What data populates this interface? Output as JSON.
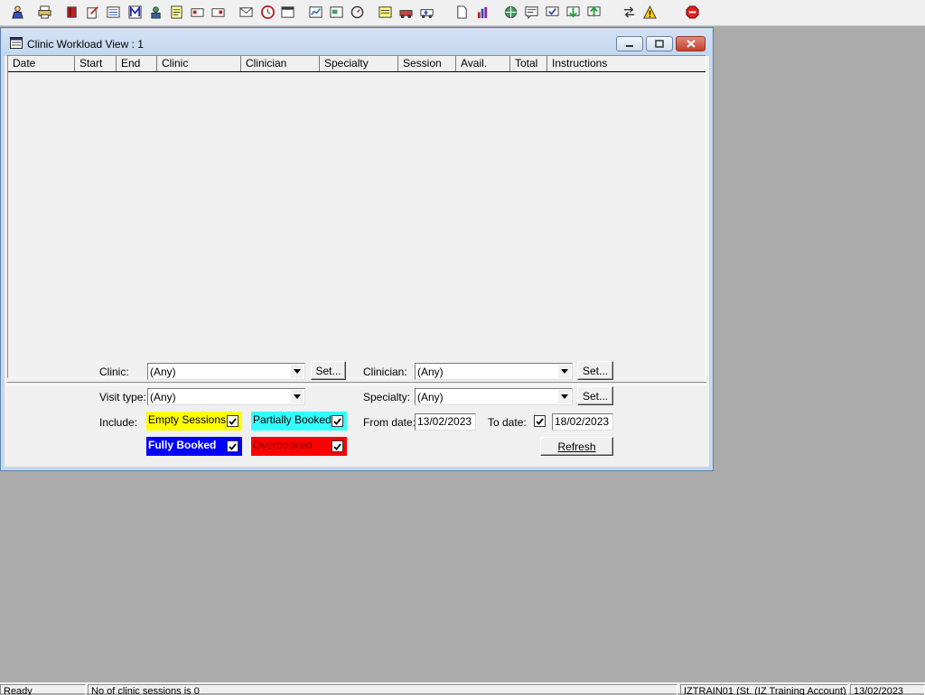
{
  "window": {
    "title": "Clinic Workload View : 1"
  },
  "list": {
    "columns": [
      "Date",
      "Start",
      "End",
      "Clinic",
      "Clinician",
      "Specialty",
      "Session",
      "Avail.",
      "Total",
      "Instructions"
    ],
    "rows": []
  },
  "form": {
    "clinic_label": "Clinic:",
    "clinic_value": "(Any)",
    "clinician_label": "Clinician:",
    "clinician_value": "(Any)",
    "visit_type_label": "Visit type:",
    "visit_type_value": "(Any)",
    "specialty_label": "Specialty:",
    "specialty_value": "(Any)",
    "set_label": "Set...",
    "include_label": "Include:",
    "empty_sessions": {
      "label": "Empty Sessions",
      "checked": true,
      "color": "#ffff00"
    },
    "partially_booked": {
      "label": "Partially Booked",
      "checked": true,
      "color": "#33ffff"
    },
    "fully_booked": {
      "label": "Fully Booked",
      "checked": true,
      "color": "#0000ff"
    },
    "overbooked": {
      "label": "Overbooked",
      "checked": true,
      "color": "#ff0000"
    },
    "from_date_label": "From date:",
    "from_date": "13/02/2023",
    "to_date_label": "To date:",
    "to_date_checked": true,
    "to_date": "18/02/2023",
    "refresh_label": "Refresh"
  },
  "statusbar": {
    "status": "Ready",
    "message": "No of clinic sessions is 0",
    "user": "IZTRAIN01 (St. (IZ Training Account)",
    "date": "13/02/2023"
  },
  "toolbar_icons": [
    "user-icon",
    "printer-icon",
    "book-icon",
    "edit-note-icon",
    "list-icon",
    "mail-icon",
    "person-icon",
    "form-icon",
    "referral-icon",
    "transfer-icon",
    "letter-icon",
    "clock-icon",
    "window-icon",
    "chart-icon",
    "report-icon",
    "timer-icon",
    "note-icon",
    "vehicle-icon",
    "ambulance-icon",
    "document-icon",
    "bar-chart-icon",
    "globe-icon",
    "message-icon",
    "message-check-icon",
    "download-icon",
    "upload-icon",
    "swap-icon",
    "warning-icon",
    "exit-icon"
  ]
}
